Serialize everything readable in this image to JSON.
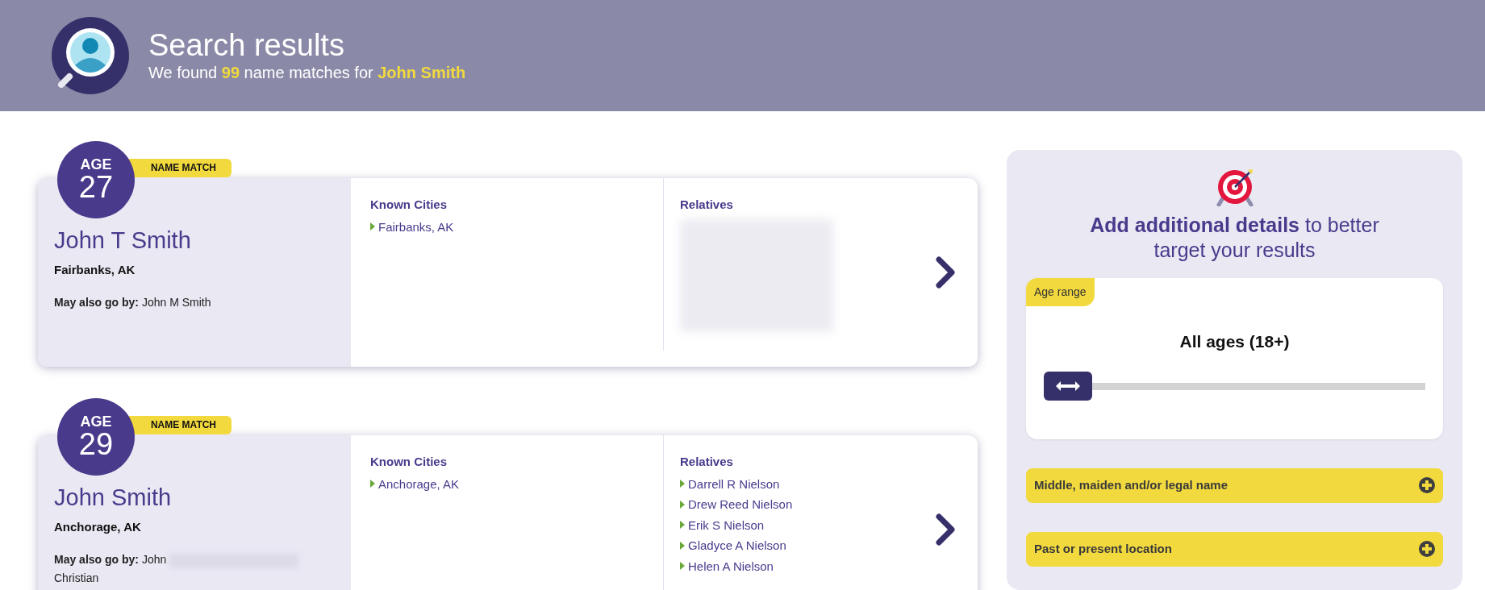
{
  "header": {
    "title": "Search results",
    "subtitle": "We found **99** name matches for **John Smith**"
  },
  "results": [
    {
      "age_label": "AGE",
      "age": "27",
      "match_badge": "NAME MATCH",
      "name": "John T Smith",
      "location": "Fairbanks, AK",
      "alias_label": "May also go by:",
      "alias_parts": [
        "John M Smith"
      ],
      "alias_redacted": false,
      "cities_heading": "Known Cities",
      "cities": [
        "Fairbanks, AK"
      ],
      "relatives_heading": "Relatives",
      "relatives_redacted": true
    },
    {
      "age_label": "AGE",
      "age": "29",
      "match_badge": "NAME MATCH",
      "name": "John Smith",
      "location": "Anchorage, AK",
      "alias_label": "May also go by:",
      "alias_parts": [
        "John",
        "Christian"
      ],
      "alias_redacted": true,
      "cities_heading": "Known Cities",
      "cities": [
        "Anchorage, AK"
      ],
      "relatives_heading": "Relatives",
      "relatives": [
        "Darrell R Nielson",
        "Drew Reed Nielson",
        "Erik S Nielson",
        "Gladyce A Nielson",
        "Helen A Nielson"
      ],
      "relatives_redacted": false
    }
  ],
  "sidebar": {
    "heading": "**Add additional details** to better target your results",
    "age_filter": {
      "tag": "Age range",
      "value_text": "All ages (18+)",
      "level": 0
    },
    "filters": [
      {
        "label": "Middle, maiden and/or legal name",
        "expanded": false
      },
      {
        "label": "Past or present location",
        "expanded": false
      }
    ]
  }
}
